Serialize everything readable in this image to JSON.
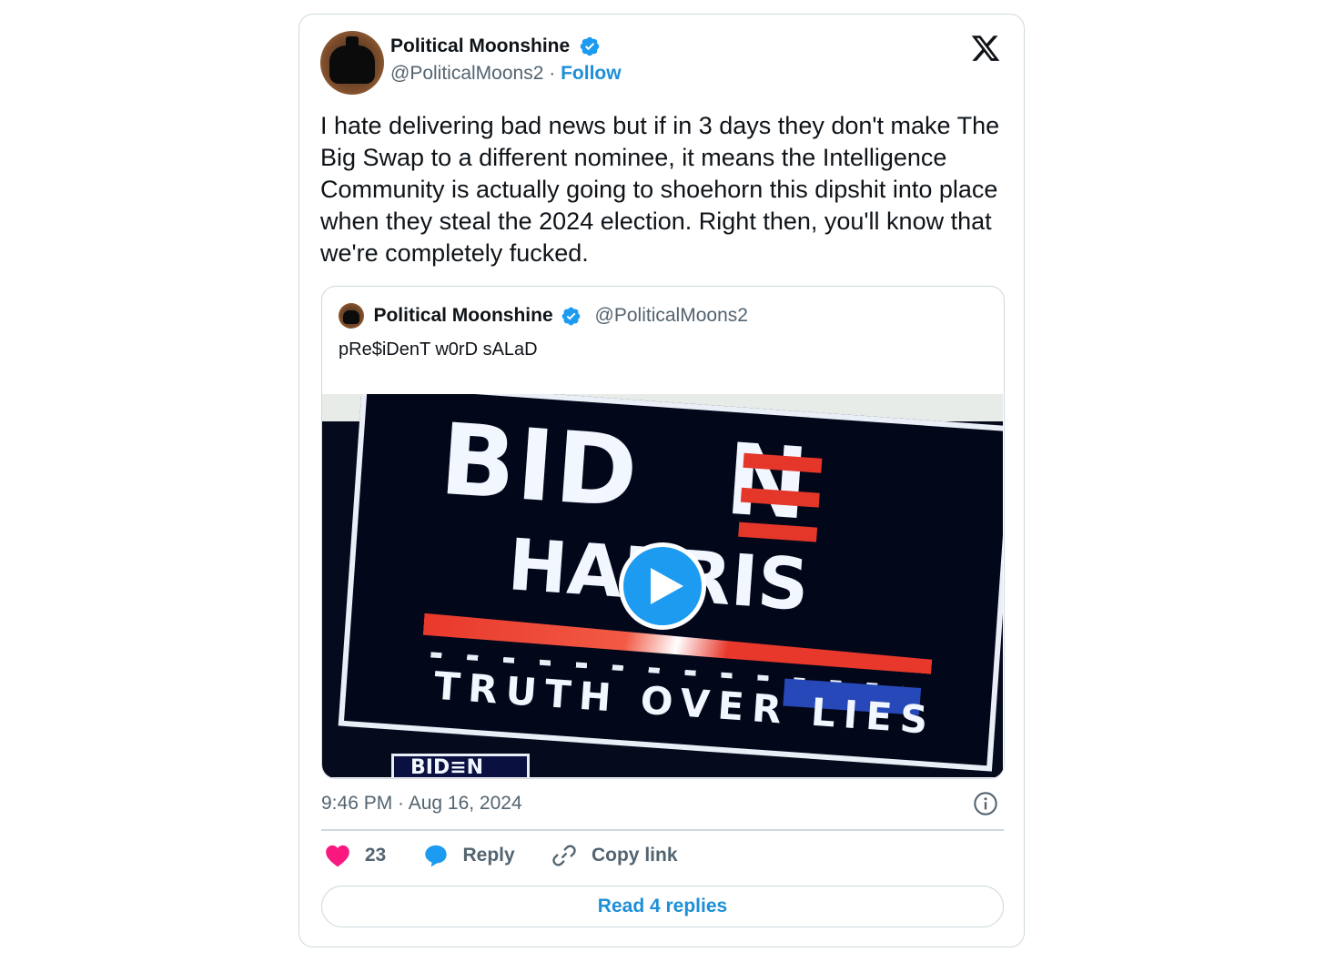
{
  "author": {
    "display_name": "Political Moonshine",
    "handle": "@PoliticalMoons2",
    "separator": "·",
    "follow_label": "Follow",
    "verified": true
  },
  "tweet": {
    "text": "I hate delivering bad news but if in 3 days they don't make The Big Swap to a different nominee, it means the Intelligence Community is actually going to shoehorn this dipshit into place when they steal the 2024 election. Right then, you'll know that we're completely fucked.",
    "timestamp": "9:46 PM · Aug 16, 2024"
  },
  "quoted_tweet": {
    "display_name": "Political Moonshine",
    "handle": "@PoliticalMoons2",
    "text": "pRe$iDenT w0rD sALaD",
    "media": {
      "type": "video",
      "sign_line1": "BID",
      "sign_line1_end": "N",
      "sign_line2": "HARRIS",
      "sign_line3": "TRUTH OVER LIES",
      "bottom_sign": "BID≡N"
    }
  },
  "actions": {
    "like_count": "23",
    "reply_label": "Reply",
    "copy_link_label": "Copy link"
  },
  "read_replies_label": "Read 4 replies",
  "colors": {
    "accent": "#1d9bf0",
    "link": "#1d8fd8",
    "heart": "#f91880",
    "muted": "#536471",
    "border": "#cfd9de"
  },
  "icons": {
    "verified": "verified-badge-icon",
    "platform": "x-logo-icon",
    "info": "info-icon",
    "like": "heart-icon",
    "reply": "speech-bubble-icon",
    "copy": "link-icon",
    "play": "play-icon"
  }
}
